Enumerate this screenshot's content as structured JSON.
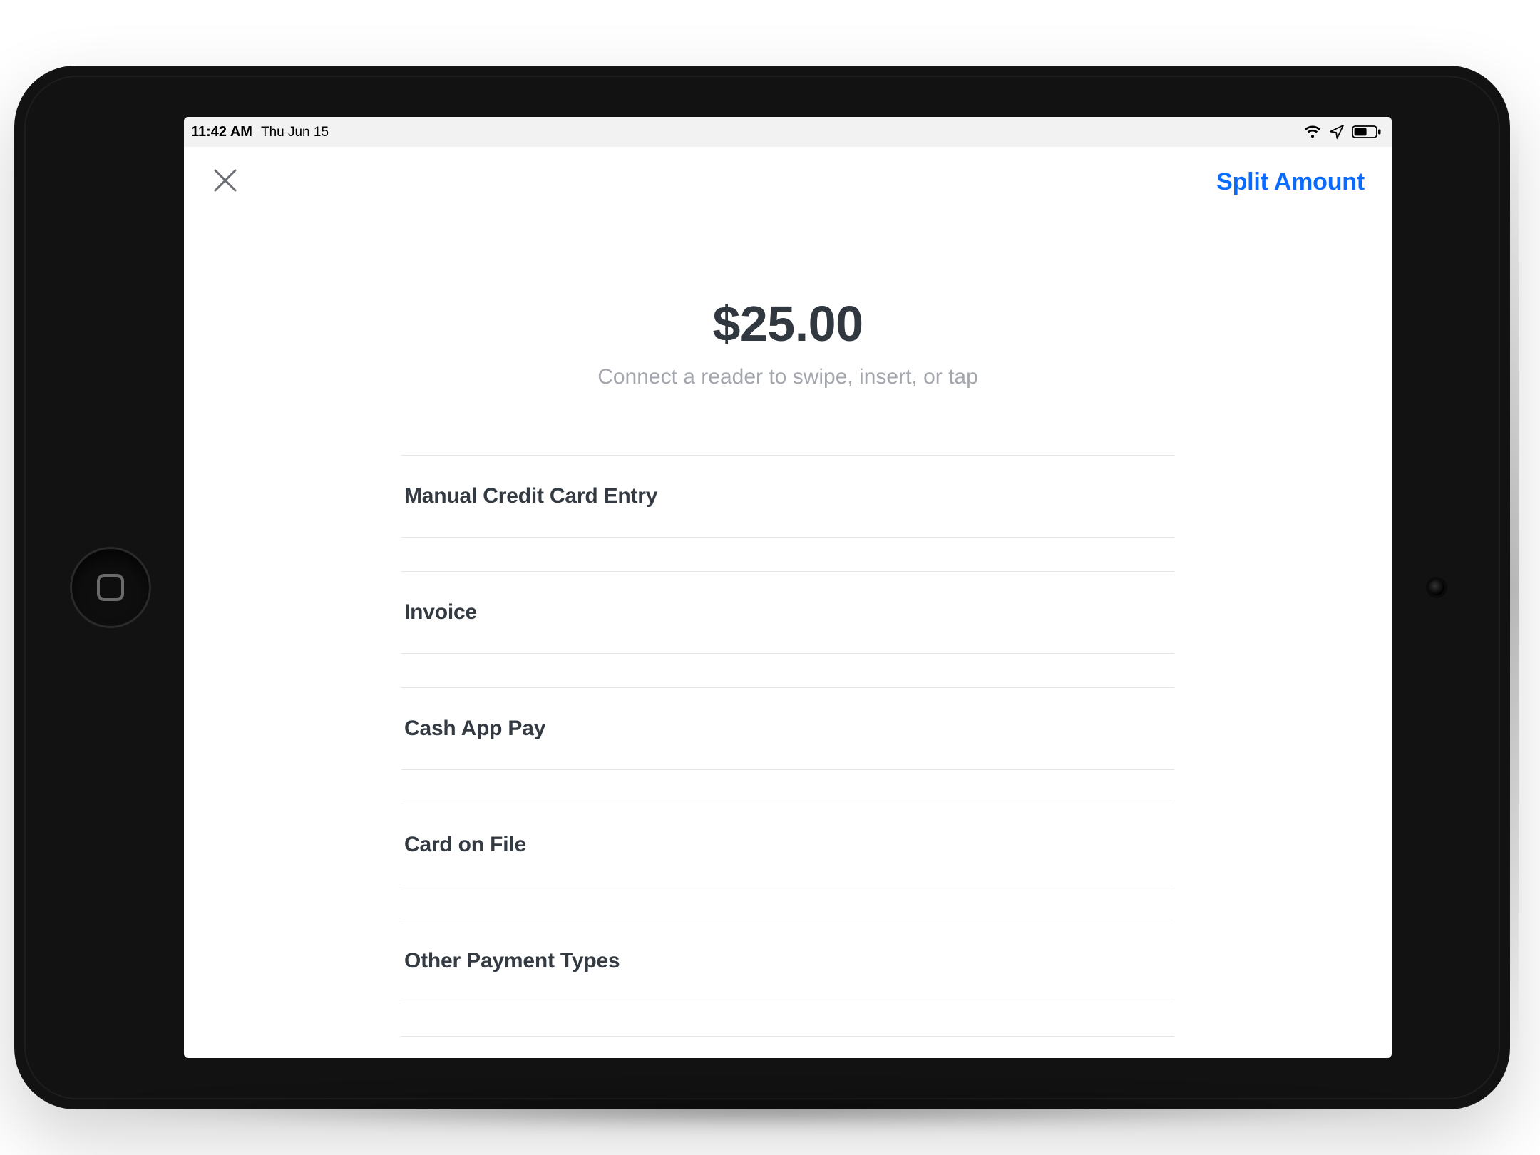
{
  "status_bar": {
    "time": "11:42 AM",
    "date": "Thu Jun 15"
  },
  "nav": {
    "split_label": "Split Amount"
  },
  "checkout": {
    "amount": "$25.00",
    "subtitle": "Connect a reader to swipe, insert, or tap"
  },
  "payment_options": [
    {
      "label": "Manual Credit Card Entry"
    },
    {
      "label": "Invoice"
    },
    {
      "label": "Cash App Pay"
    },
    {
      "label": "Card on File"
    },
    {
      "label": "Other Payment Types"
    }
  ]
}
